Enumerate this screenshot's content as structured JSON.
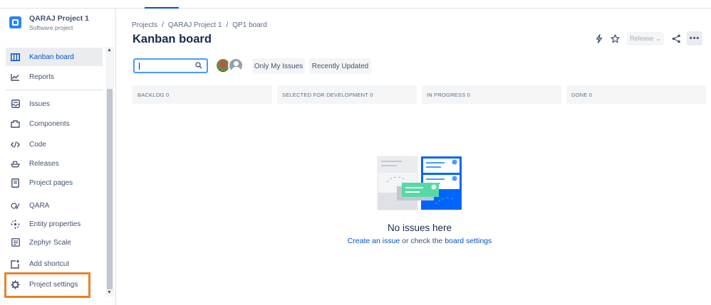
{
  "project": {
    "name": "QARAJ Project 1",
    "type": "Software project"
  },
  "sidebar": {
    "items": [
      {
        "label": "Kanban board",
        "icon": "board-columns-icon",
        "active": true
      },
      {
        "label": "Reports",
        "icon": "chart-line-icon"
      },
      {
        "label": "Issues",
        "icon": "inbox-icon"
      },
      {
        "label": "Components",
        "icon": "component-icon"
      },
      {
        "label": "Code",
        "icon": "code-icon"
      },
      {
        "label": "Releases",
        "icon": "ship-icon"
      },
      {
        "label": "Project pages",
        "icon": "page-icon"
      },
      {
        "label": "QARA",
        "icon": "qara-icon"
      },
      {
        "label": "Entity properties",
        "icon": "entity-icon"
      },
      {
        "label": "Zephyr Scale",
        "icon": "zephyr-icon"
      },
      {
        "label": "Add shortcut",
        "icon": "add-shortcut-icon"
      },
      {
        "label": "Project settings",
        "icon": "gear-icon"
      }
    ]
  },
  "breadcrumb": [
    "Projects",
    "QARAJ Project 1",
    "QP1 board"
  ],
  "page": {
    "title": "Kanban board"
  },
  "header": {
    "release_label": "Release"
  },
  "toolbar": {
    "search_value": "",
    "filters": [
      "Only My Issues",
      "Recently Updated"
    ]
  },
  "columns": [
    {
      "name": "BACKLOG",
      "count": "0"
    },
    {
      "name": "SELECTED FOR DEVELOPMENT",
      "count": "0"
    },
    {
      "name": "IN PROGRESS",
      "count": "0"
    },
    {
      "name": "DONE",
      "count": "0"
    }
  ],
  "empty_state": {
    "title": "No issues here",
    "link1": "Create an issue",
    "middle": " or check the ",
    "link2": "board settings"
  },
  "colors": {
    "accent": "#0052cc",
    "highlight": "#e8832b"
  }
}
